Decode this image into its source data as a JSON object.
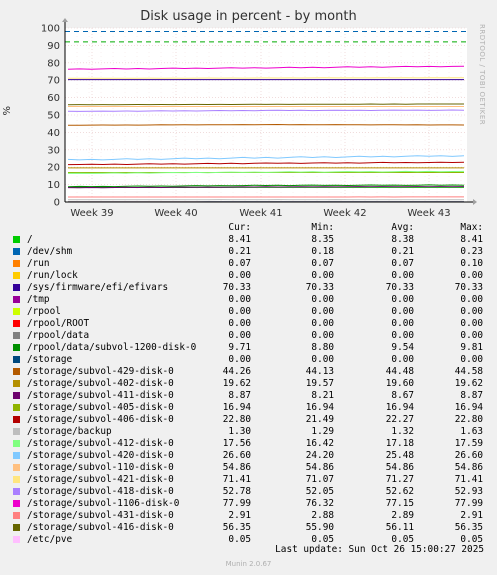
{
  "side_label": "RRDTOOL / TOBI OETIKER",
  "footer": {
    "last_update": "Last update: Sun Oct 26 15:00:27 2025",
    "version": "Munin 2.0.67"
  },
  "legend_headers": {
    "cur": "Cur:",
    "min": "Min:",
    "avg": "Avg:",
    "max": "Max:"
  },
  "chart_data": {
    "type": "line",
    "title": "Disk usage in percent - by month",
    "ylabel": "%",
    "xlabel": "",
    "ylim": [
      0,
      100
    ],
    "yticks": [
      0,
      10,
      20,
      30,
      40,
      50,
      60,
      70,
      80,
      90,
      100
    ],
    "xticks": [
      "Week 39",
      "Week 40",
      "Week 41",
      "Week 42",
      "Week 43"
    ],
    "grid": true,
    "warning_lines": [
      92,
      98
    ],
    "series": [
      {
        "name": "/",
        "color": "#00cc00",
        "cur": "8.41",
        "min": "8.35",
        "avg": "8.38",
        "max": "8.41"
      },
      {
        "name": "/dev/shm",
        "color": "#0066b3",
        "cur": "0.21",
        "min": "0.18",
        "min_": "",
        "avg": "0.21",
        "max": "0.23"
      },
      {
        "name": "/run",
        "color": "#ff8000",
        "cur": "0.07",
        "min": "0.07",
        "avg": "0.07",
        "max": "0.10"
      },
      {
        "name": "/run/lock",
        "color": "#ffcc00",
        "cur": "0.00",
        "min": "0.00",
        "avg": "0.00",
        "max": "0.00"
      },
      {
        "name": "/sys/firmware/efi/efivars",
        "color": "#330099",
        "cur": "70.33",
        "min": "70.33",
        "avg": "70.33",
        "max": "70.33"
      },
      {
        "name": "/tmp",
        "color": "#990099",
        "cur": "0.00",
        "min": "0.00",
        "avg": "0.00",
        "max": "0.00"
      },
      {
        "name": "/rpool",
        "color": "#ccff00",
        "cur": "0.00",
        "min": "0.00",
        "avg": "0.00",
        "max": "0.00"
      },
      {
        "name": "/rpool/ROOT",
        "color": "#ff0000",
        "cur": "0.00",
        "min": "0.00",
        "avg": "0.00",
        "max": "0.00"
      },
      {
        "name": "/rpool/data",
        "color": "#808080",
        "cur": "0.00",
        "min": "0.00",
        "avg": "0.00",
        "max": "0.00"
      },
      {
        "name": "/rpool/data/subvol-1200-disk-0",
        "color": "#008f00",
        "cur": "9.71",
        "min": "8.80",
        "avg": "9.54",
        "max": "9.81"
      },
      {
        "name": "/storage",
        "color": "#00487d",
        "cur": "0.00",
        "min": "0.00",
        "avg": "0.00",
        "max": "0.00"
      },
      {
        "name": "/storage/subvol-429-disk-0",
        "color": "#b35a00",
        "cur": "44.26",
        "min": "44.13",
        "avg": "44.48",
        "max": "44.58"
      },
      {
        "name": "/storage/subvol-402-disk-0",
        "color": "#b38f00",
        "cur": "19.62",
        "min": "19.57",
        "avg": "19.60",
        "max": "19.62"
      },
      {
        "name": "/storage/subvol-411-disk-0",
        "color": "#6b006b",
        "cur": "8.87",
        "min": "8.21",
        "avg": "8.67",
        "max": "8.87"
      },
      {
        "name": "/storage/subvol-405-disk-0",
        "color": "#8fb300",
        "cur": "16.94",
        "min": "16.94",
        "avg": "16.94",
        "max": "16.94"
      },
      {
        "name": "/storage/subvol-406-disk-0",
        "color": "#b30000",
        "cur": "22.80",
        "min": "21.49",
        "avg": "22.27",
        "max": "22.80"
      },
      {
        "name": "/storage/backup",
        "color": "#bebebe",
        "cur": "1.30",
        "min": "1.29",
        "avg": "1.32",
        "max": "1.63"
      },
      {
        "name": "/storage/subvol-412-disk-0",
        "color": "#80ff80",
        "cur": "17.56",
        "min": "16.42",
        "avg": "17.18",
        "max": "17.59"
      },
      {
        "name": "/storage/subvol-420-disk-0",
        "color": "#80c9ff",
        "cur": "26.60",
        "min": "24.20",
        "avg": "25.48",
        "max": "26.60"
      },
      {
        "name": "/storage/subvol-110-disk-0",
        "color": "#ffc080",
        "cur": "54.86",
        "min": "54.86",
        "avg": "54.86",
        "max": "54.86"
      },
      {
        "name": "/storage/subvol-421-disk-0",
        "color": "#ffe680",
        "cur": "71.41",
        "min": "71.07",
        "avg": "71.27",
        "max": "71.41"
      },
      {
        "name": "/storage/subvol-418-disk-0",
        "color": "#aa80ff",
        "cur": "52.78",
        "min": "52.05",
        "avg": "52.62",
        "max": "52.93"
      },
      {
        "name": "/storage/subvol-1106-disk-0",
        "color": "#ee00cc",
        "cur": "77.99",
        "min": "76.32",
        "avg": "77.15",
        "max": "77.99"
      },
      {
        "name": "/storage/subvol-431-disk-0",
        "color": "#ff8080",
        "cur": "2.91",
        "min": "2.88",
        "avg": "2.89",
        "max": "2.91"
      },
      {
        "name": "/storage/subvol-416-disk-0",
        "color": "#666600",
        "cur": "56.35",
        "min": "55.90",
        "avg": "56.11",
        "max": "56.35"
      },
      {
        "name": "/etc/pve",
        "color": "#ffbfff",
        "cur": "0.05",
        "min": "0.05",
        "avg": "0.05",
        "max": "0.05"
      }
    ]
  }
}
